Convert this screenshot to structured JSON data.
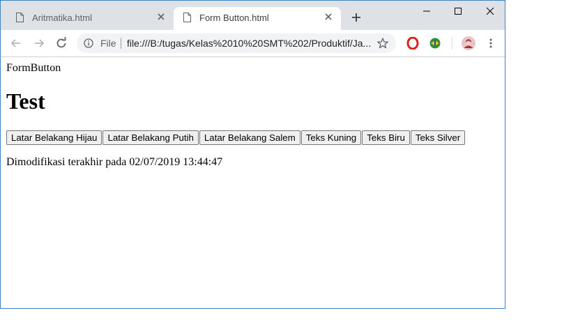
{
  "browser": {
    "tabs": [
      {
        "title": "Aritmatika.html",
        "active": false
      },
      {
        "title": "Form Button.html",
        "active": true
      }
    ],
    "omnibox": {
      "scheme_label": "File",
      "url": "file:///B:/tugas/Kelas%2010%20SMT%202/Produktif/Ja..."
    }
  },
  "page": {
    "line1": "FormButton",
    "heading": "Test",
    "buttons": [
      "Latar Belakang Hijau",
      "Latar Belakang Putih",
      "Latar Belakang Salem",
      "Teks Kuning",
      "Teks Biru",
      "Teks Silver"
    ],
    "modified_text": "Dimodifikasi terakhir pada 02/07/2019 13:44:47"
  },
  "colors": {
    "tabstrip": "#dee1e6",
    "window_border": "#3a83c6",
    "opera_red": "#e0201b"
  }
}
